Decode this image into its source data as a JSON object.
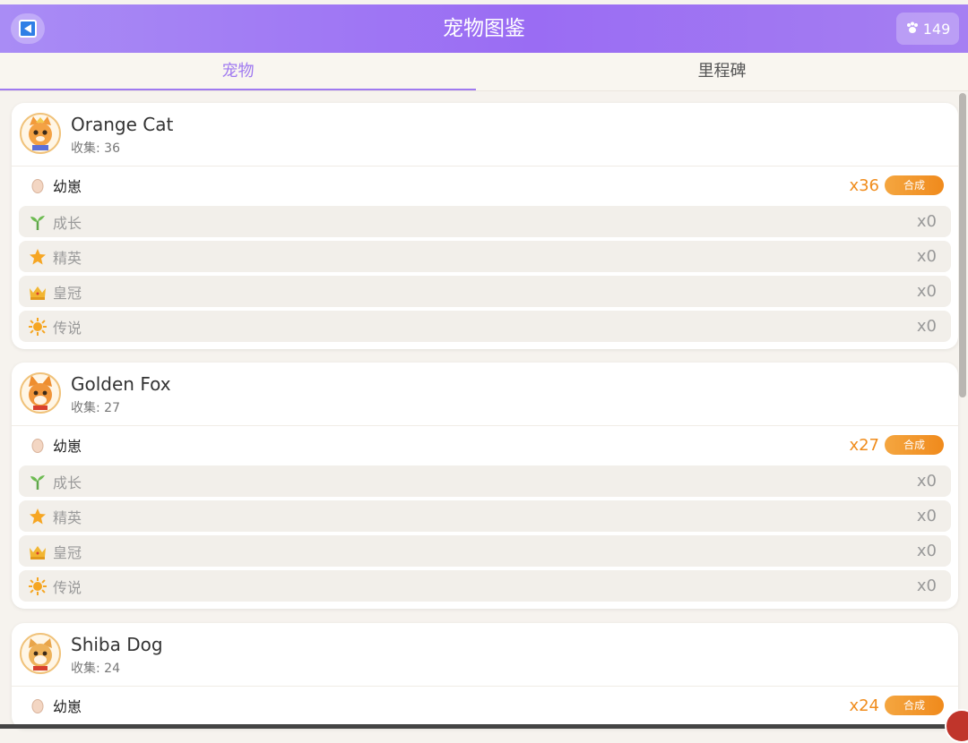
{
  "header": {
    "title": "宠物图鉴",
    "coins": "149",
    "back_icon": "back-arrow-icon",
    "coin_icon": "paw-icon"
  },
  "tabs": [
    {
      "label": "宠物",
      "active": true
    },
    {
      "label": "里程碑",
      "active": false
    }
  ],
  "cards": [
    {
      "name": "Orange Cat",
      "collect": "收集: 36",
      "avatar_icon": "orange-cat-avatar-icon",
      "stages": [
        {
          "label": "幼崽",
          "count": "x36",
          "icon": "egg-icon",
          "action": "合成"
        },
        {
          "label": "成长",
          "count": "x0",
          "icon": "sprout-icon"
        },
        {
          "label": "精英",
          "count": "x0",
          "icon": "star-icon"
        },
        {
          "label": "皇冠",
          "count": "x0",
          "icon": "crown-icon"
        },
        {
          "label": "传说",
          "count": "x0",
          "icon": "sun-icon"
        }
      ]
    },
    {
      "name": "Golden Fox",
      "collect": "收集: 27",
      "avatar_icon": "golden-fox-avatar-icon",
      "stages": [
        {
          "label": "幼崽",
          "count": "x27",
          "icon": "egg-icon",
          "action": "合成"
        },
        {
          "label": "成长",
          "count": "x0",
          "icon": "sprout-icon"
        },
        {
          "label": "精英",
          "count": "x0",
          "icon": "star-icon"
        },
        {
          "label": "皇冠",
          "count": "x0",
          "icon": "crown-icon"
        },
        {
          "label": "传说",
          "count": "x0",
          "icon": "sun-icon"
        }
      ]
    },
    {
      "name": "Shiba Dog",
      "collect": "收集: 24",
      "avatar_icon": "shiba-dog-avatar-icon",
      "stages": [
        {
          "label": "幼崽",
          "count": "x24",
          "icon": "egg-icon",
          "action": "合成"
        }
      ]
    }
  ],
  "colors": {
    "header": "#9a6cf3",
    "accent": "#a07af0",
    "merge": "#f08a1c"
  }
}
